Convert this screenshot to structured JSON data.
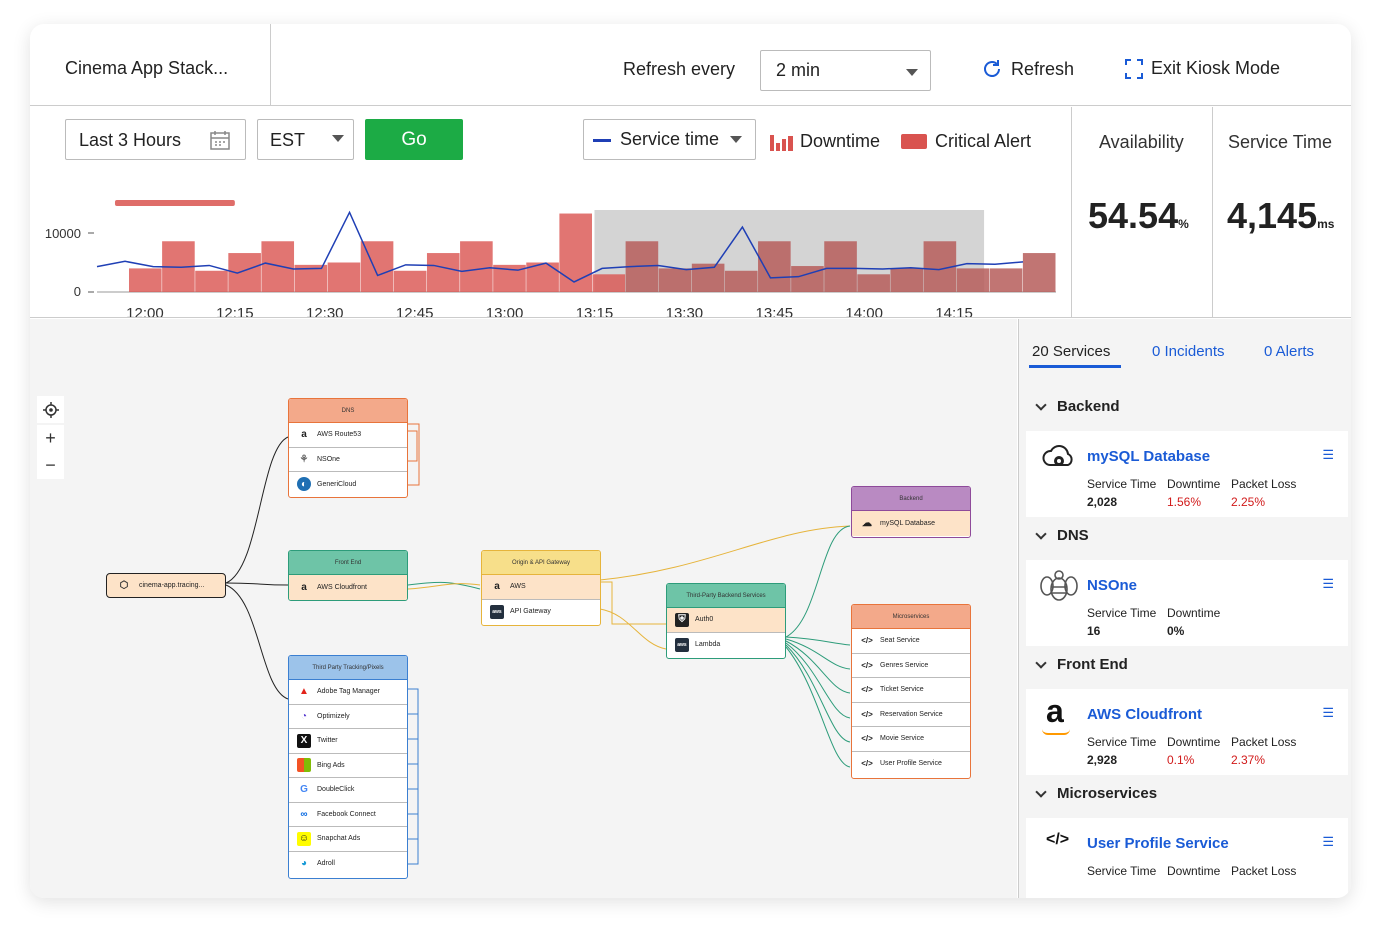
{
  "header": {
    "app_title": "Cinema App Stack...",
    "refresh_every_label": "Refresh every",
    "refresh_interval": "2 min",
    "refresh_button": "Refresh",
    "exit_kiosk_button": "Exit Kiosk Mode"
  },
  "controls": {
    "time_range": "Last 3 Hours",
    "timezone": "EST",
    "go_label": "Go",
    "series_select": "Service time",
    "legend_downtime": "Downtime",
    "legend_critical": "Critical Alert"
  },
  "metrics": {
    "availability_label": "Availability",
    "availability_value": "54.54",
    "availability_unit": "%",
    "service_time_label": "Service Time",
    "service_time_value": "4,145",
    "service_time_unit": "ms"
  },
  "chart_data": {
    "type": "bar",
    "y_ticks": [
      "10000",
      "0"
    ],
    "ylim": [
      0,
      14000
    ],
    "x_tick_labels": [
      "12:00",
      "12:15",
      "12:30",
      "12:45",
      "13:00",
      "13:15",
      "13:30",
      "13:45",
      "14:00",
      "14:15"
    ],
    "downtime_bars": [
      4000,
      8600,
      3600,
      6600,
      8600,
      4600,
      5000,
      8600,
      3600,
      6600,
      8600,
      4600,
      5000,
      13300,
      3000,
      8600,
      4000,
      4800,
      3600,
      8600,
      4400,
      8600,
      3000,
      4000,
      8600,
      4000,
      4000,
      6600
    ],
    "service_time_line": [
      4300,
      5200,
      4300,
      4200,
      4500,
      3200,
      4900,
      3900,
      4000,
      13500,
      2800,
      4600,
      4500,
      3500,
      4100,
      3700,
      4900,
      1700,
      4000,
      4300,
      4500,
      3800,
      4200,
      11000,
      2400,
      2600,
      4000,
      4000,
      3900,
      4100,
      3800,
      4800,
      4700,
      5100
    ],
    "critical_alert_span": [
      "11:55",
      "12:15"
    ],
    "shaded_span": [
      "13:15",
      "14:20"
    ],
    "colors": {
      "downtime": "#d9534f",
      "line": "#1f3fb5",
      "critical": "#d9534f",
      "go": "#1cab45",
      "link": "#1a5bd6"
    }
  },
  "map": {
    "root": "cinema-app.tracing...",
    "dns": {
      "title": "DNS",
      "items": [
        "AWS Route53",
        "NSOne",
        "GeneriCloud"
      ]
    },
    "frontend": {
      "title": "Front End",
      "items": [
        "AWS Cloudfront"
      ]
    },
    "tracking": {
      "title": "Third Party Tracking/Pixels",
      "items": [
        "Adobe Tag Manager",
        "Optimizely",
        "Twitter",
        "Bing Ads",
        "DoubleClick",
        "Facebook Connect",
        "Snapchat Ads",
        "Adroll"
      ]
    },
    "origin": {
      "title": "Origin & API Gateway",
      "items": [
        "AWS",
        "API Gateway"
      ]
    },
    "thirdparty_backend": {
      "title": "Third-Party Backend Services",
      "items": [
        "Auth0",
        "Lambda"
      ]
    },
    "backend": {
      "title": "Backend",
      "items": [
        "mySQL Database"
      ]
    },
    "microservices": {
      "title": "Microservices",
      "items": [
        "Seat Service",
        "Genres Service",
        "Ticket Service",
        "Reservation Service",
        "Movie Service",
        "User Profile Service"
      ]
    }
  },
  "side": {
    "tabs": [
      "20 Services",
      "0 Incidents",
      "0 Alerts"
    ],
    "groups": [
      {
        "name": "Backend",
        "service": "mySQL Database",
        "labels": [
          "Service Time",
          "Downtime",
          "Packet Loss"
        ],
        "values": [
          "2,028",
          "1.56%",
          "2.25%"
        ]
      },
      {
        "name": "DNS",
        "service": "NSOne",
        "labels": [
          "Service Time",
          "Downtime"
        ],
        "values": [
          "16",
          "0%"
        ]
      },
      {
        "name": "Front End",
        "service": "AWS Cloudfront",
        "labels": [
          "Service Time",
          "Downtime",
          "Packet Loss"
        ],
        "values": [
          "2,928",
          "0.1%",
          "2.37%"
        ]
      },
      {
        "name": "Microservices",
        "service": "User Profile Service",
        "labels": [
          "Service Time",
          "Downtime",
          "Packet Loss"
        ]
      }
    ]
  }
}
